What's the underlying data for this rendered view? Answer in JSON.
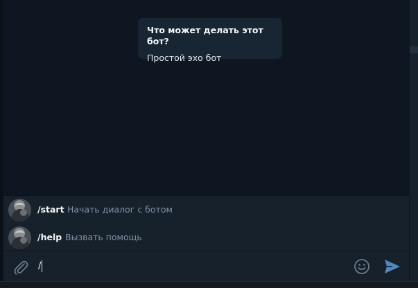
{
  "bot_info": {
    "title": "Что может делать этот бот?",
    "description": "Простой эхо бот"
  },
  "commands": [
    {
      "name": "/start",
      "description": "Начать диалог с ботом"
    },
    {
      "name": "/help",
      "description": "Вызвать помощь"
    }
  ],
  "composer": {
    "input_value": "/",
    "icons": [
      "paperclip-icon",
      "emoji-icon",
      "send-icon"
    ]
  },
  "colors": {
    "background": "#0e1621",
    "panel": "#17212b",
    "card": "#182533",
    "accent": "#5288c1",
    "muted_text": "#7f91a4"
  }
}
